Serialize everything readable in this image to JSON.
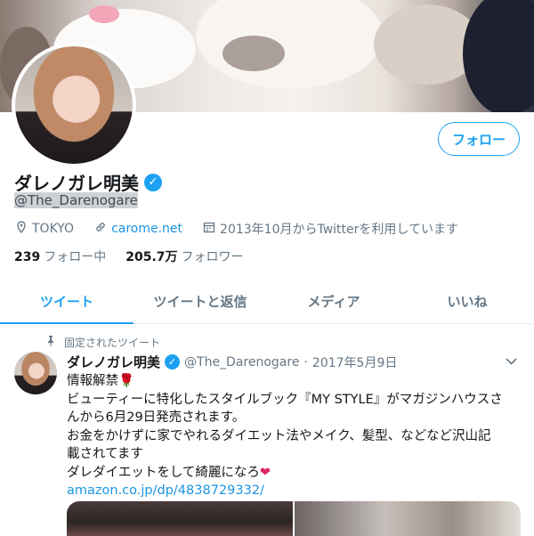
{
  "profile": {
    "name": "ダレノガレ明美",
    "handle": "@The_Darenogare",
    "location": "TOKYO",
    "website": "carome.net",
    "joined": "2013年10月からTwitterを利用しています",
    "follow_label": "フォロー",
    "following_count": "239",
    "following_label": "フォロー中",
    "followers_count": "205.7万",
    "followers_label": "フォロワー",
    "verified_mark": "✓"
  },
  "tabs": [
    {
      "label": "ツイート",
      "active": true
    },
    {
      "label": "ツイートと返信",
      "active": false
    },
    {
      "label": "メディア",
      "active": false
    },
    {
      "label": "いいね",
      "active": false
    }
  ],
  "tweet": {
    "pinned_label": "固定されたツイート",
    "name": "ダレノガレ明美",
    "handle": "@The_Darenogare",
    "separator": "·",
    "date": "2017年5月9日",
    "lines": [
      "情報解禁",
      "ビューティーに特化したスタイルブック『MY STYLE』がマガジンハウスさ",
      "んから6月29日発売されます。",
      "お金をかけずに家でやれるダイエット法やメイク、髪型、などなど沢山記",
      "載されてます",
      "ダレダイエットをして綺麗になろ"
    ],
    "link": "amazon.co.jp/dp/4838729332/",
    "rose_emoji": "🌹",
    "heart_emoji": "❤"
  },
  "icons": {
    "location": "location-pin-icon",
    "link": "link-icon",
    "calendar": "calendar-icon",
    "pin": "pin-icon",
    "caret": "chevron-down-icon"
  },
  "colors": {
    "accent": "#1da1f2",
    "link": "#1b95e0",
    "muted": "#657786"
  }
}
